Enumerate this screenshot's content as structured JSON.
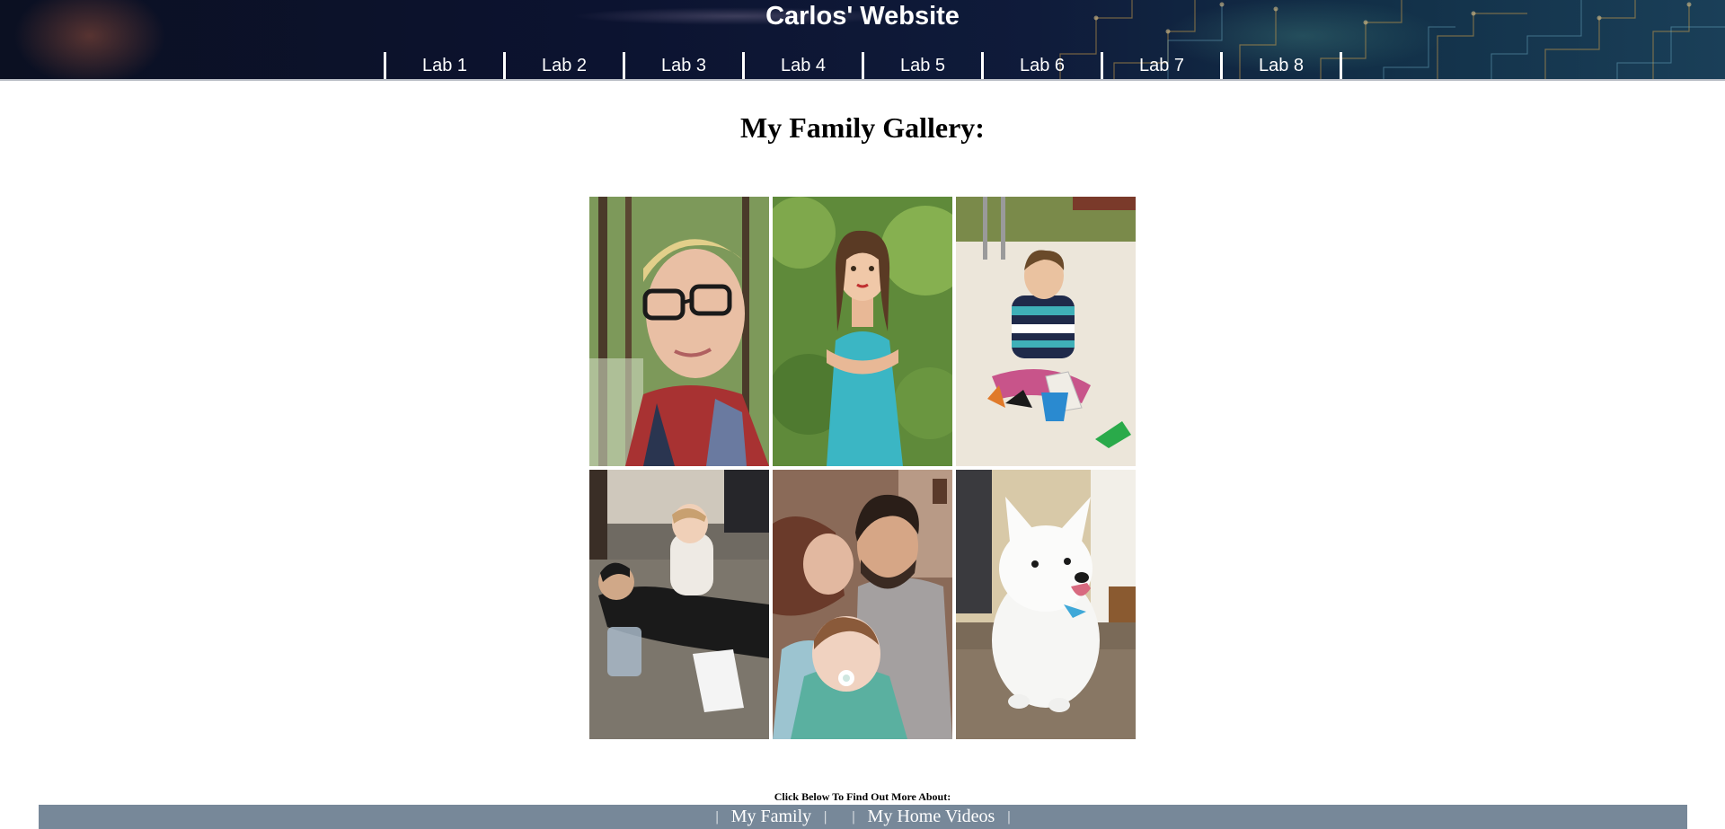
{
  "header": {
    "site_title": "Carlos' Website",
    "nav": [
      {
        "label": "Lab 1"
      },
      {
        "label": "Lab 2"
      },
      {
        "label": "Lab 3"
      },
      {
        "label": "Lab 4"
      },
      {
        "label": "Lab 5"
      },
      {
        "label": "Lab 6"
      },
      {
        "label": "Lab 7"
      },
      {
        "label": "Lab 8"
      }
    ]
  },
  "gallery": {
    "title": "My Family Gallery:",
    "photos": [
      {
        "subject": "woman-with-glasses-selfie"
      },
      {
        "subject": "girl-in-blue-dress"
      },
      {
        "subject": "boy-in-sandbox"
      },
      {
        "subject": "man-with-baby-on-back"
      },
      {
        "subject": "family-kiss-with-baby"
      },
      {
        "subject": "white-fluffy-dog"
      }
    ]
  },
  "footer": {
    "prompt": "Click Below To Find Out More About:",
    "separator": "|",
    "links": [
      {
        "label": "My Family"
      },
      {
        "label": "My Home Videos"
      }
    ]
  },
  "colors": {
    "header_bg": "#0c1330",
    "footer_bar": "#778899",
    "text_white": "#ffffff"
  }
}
